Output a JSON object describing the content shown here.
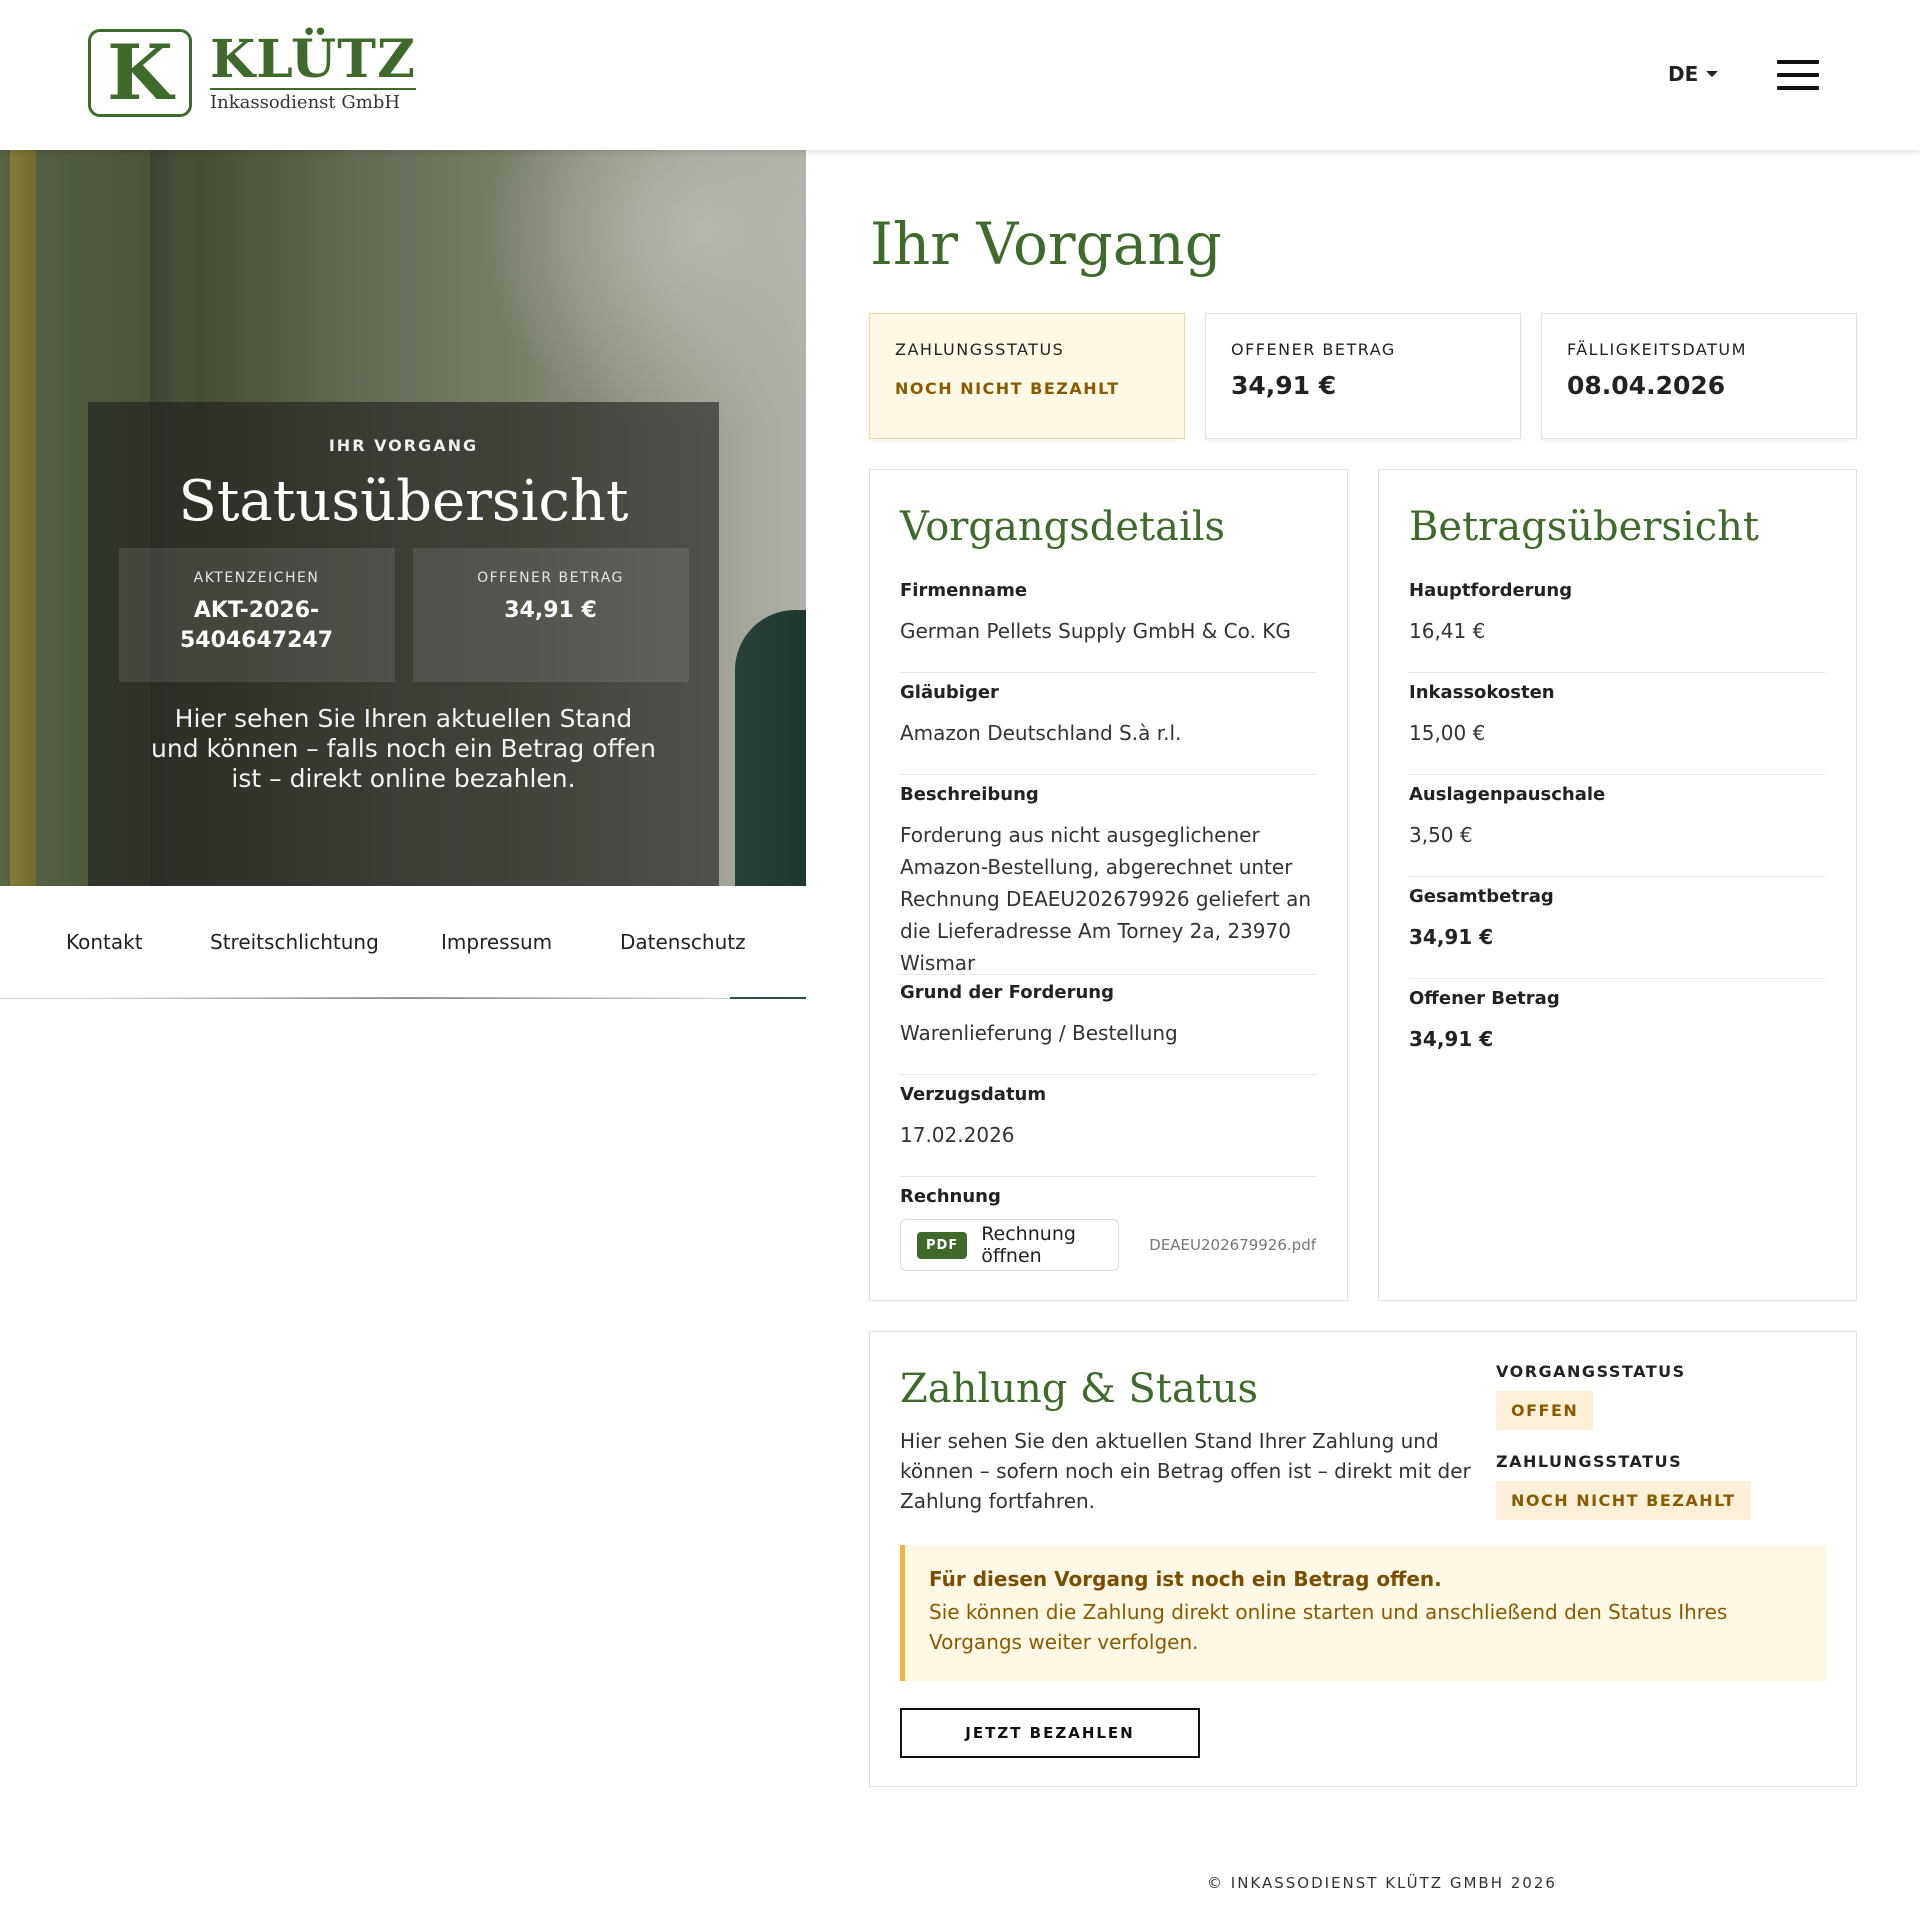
{
  "header": {
    "logo_letter": "K",
    "logo_name": "KLÜTZ",
    "logo_sub": "Inkassodienst GmbH",
    "language": "DE"
  },
  "hero": {
    "kicker": "IHR VORGANG",
    "title": "Statusübersicht",
    "box1_label": "AKTENZEICHEN",
    "box1_value": "AKT-2026-5404647247",
    "box2_label": "OFFENER BETRAG",
    "box2_value": "34,91 €",
    "text": "Hier sehen Sie Ihren aktuellen Stand und können – falls noch ein Betrag offen ist – direkt online bezahlen."
  },
  "footer_nav": [
    "Kontakt",
    "Streitschlichtung",
    "Impressum",
    "Datenschutz"
  ],
  "page": {
    "title": "Ihr Vorgang"
  },
  "summary": [
    {
      "label": "ZAHLUNGSSTATUS",
      "value": "NOCH NICHT BEZAHLT"
    },
    {
      "label": "OFFENER BETRAG",
      "value": "34,91 €"
    },
    {
      "label": "FÄLLIGKEITSDATUM",
      "value": "08.04.2026"
    }
  ],
  "details": {
    "title": "Vorgangsdetails",
    "fields": [
      {
        "label": "Firmenname",
        "value": "German Pellets Supply GmbH & Co. KG"
      },
      {
        "label": "Gläubiger",
        "value": "Amazon Deutschland S.à r.l."
      },
      {
        "label": "Beschreibung",
        "value": "Forderung aus nicht ausgeglichener Amazon-Bestellung, abgerechnet unter Rechnung DEAEU202679926 geliefert an die Lieferadresse Am Torney 2a, 23970 Wismar"
      },
      {
        "label": "Grund der Forderung",
        "value": "Warenlieferung / Bestellung"
      },
      {
        "label": "Verzugsdatum",
        "value": "17.02.2026"
      }
    ],
    "invoice_label": "Rechnung",
    "invoice_badge": "PDF",
    "invoice_button": "Rechnung öffnen",
    "invoice_file": "DEAEU202679926.pdf"
  },
  "amounts": {
    "title": "Betragsübersicht",
    "fields": [
      {
        "label": "Hauptforderung",
        "value": "16,41 €"
      },
      {
        "label": "Inkassokosten",
        "value": "15,00 €"
      },
      {
        "label": "Auslagenpauschale",
        "value": "3,50 €"
      },
      {
        "label": "Gesamtbetrag",
        "value": "34,91 €"
      },
      {
        "label": "Offener Betrag",
        "value": "34,91 €"
      }
    ]
  },
  "payment": {
    "title": "Zahlung & Status",
    "text": "Hier sehen Sie den aktuellen Stand Ihrer Zahlung und können – sofern noch ein Betrag offen ist – direkt mit der Zahlung fortfahren.",
    "vorgang_label": "VORGANGSSTATUS",
    "vorgang_value": "OFFEN",
    "zahlung_label": "ZAHLUNGSSTATUS",
    "zahlung_value": "NOCH NICHT BEZAHLT",
    "alert_title": "Für diesen Vorgang ist noch ein Betrag offen.",
    "alert_text": "Sie können die Zahlung direkt online starten und anschließend den Status Ihres Vorgangs weiter verfolgen.",
    "button": "JETZT BEZAHLEN"
  },
  "footer": {
    "copyright": "© INKASSODIENST KLÜTZ GMBH 2026"
  },
  "colors": {
    "brand_green": "#3f6a2c",
    "warning_bg": "#fff8e5",
    "warning_text": "#8a5a00",
    "warning_border": "#f0b34a"
  }
}
